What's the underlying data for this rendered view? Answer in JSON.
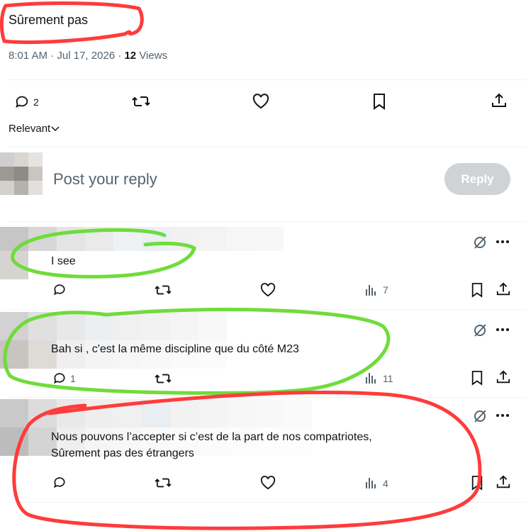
{
  "tweet": {
    "text": "Sûrement pas",
    "time": "8:01 AM",
    "date": "Jul 17, 2026",
    "views_count": "12",
    "views_label": "Views",
    "reply_count": "2"
  },
  "sort": {
    "label": "Relevant"
  },
  "composer": {
    "placeholder": "Post your reply",
    "button": "Reply"
  },
  "replies": [
    {
      "text": "I see",
      "reply_count": "",
      "views": "7"
    },
    {
      "text": "Bah si , c'est la même discipline que du côté M23",
      "reply_count": "1",
      "views": "11"
    },
    {
      "text_line1": "Nous pouvons l’accepter si c’est de la part de nos compatriotes,",
      "text_line2": "Sûrement pas des étrangers",
      "reply_count": "",
      "views": "4"
    }
  ],
  "annotations": {
    "red": "#ff3b3b",
    "green": "#6fdc3a"
  }
}
